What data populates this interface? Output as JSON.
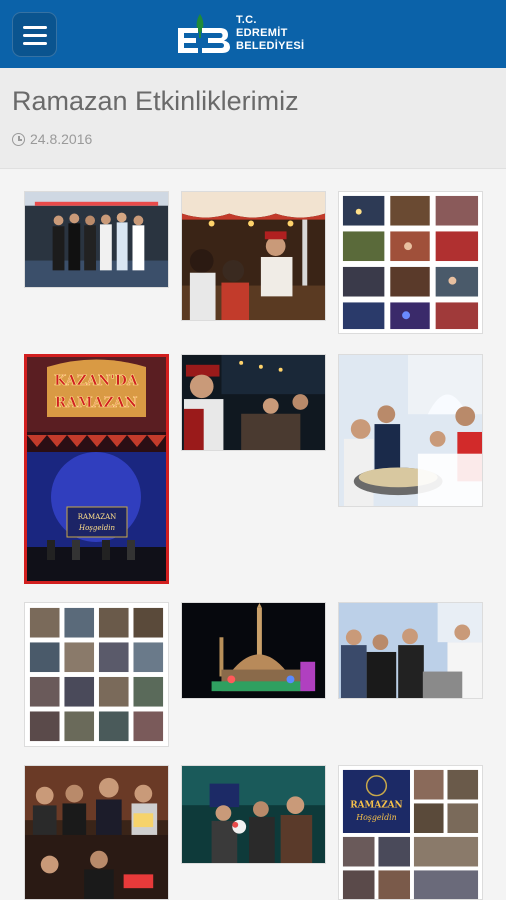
{
  "header": {
    "logo_lines": [
      "T.C.",
      "EDREMİT",
      "BELEDİYESİ"
    ],
    "menu_icon": "hamburger-icon",
    "colors": {
      "bar": "#0b62a9",
      "accent": "#1f8a3a"
    }
  },
  "article": {
    "title": "Ramazan Etkinliklerimiz",
    "date": "24.8.2016",
    "date_icon": "clock-icon"
  },
  "gallery": {
    "poster_title_line1": "KAZAN'DA",
    "poster_title_line2": "RAMAZAN",
    "poster_banner_line1": "RAMAZAN",
    "poster_banner_line2": "Hoşgeldin",
    "card_banner_line1": "RAMAZAN",
    "card_banner_line2": "Hoşgeldin",
    "selected_border": "#d21f1f"
  }
}
